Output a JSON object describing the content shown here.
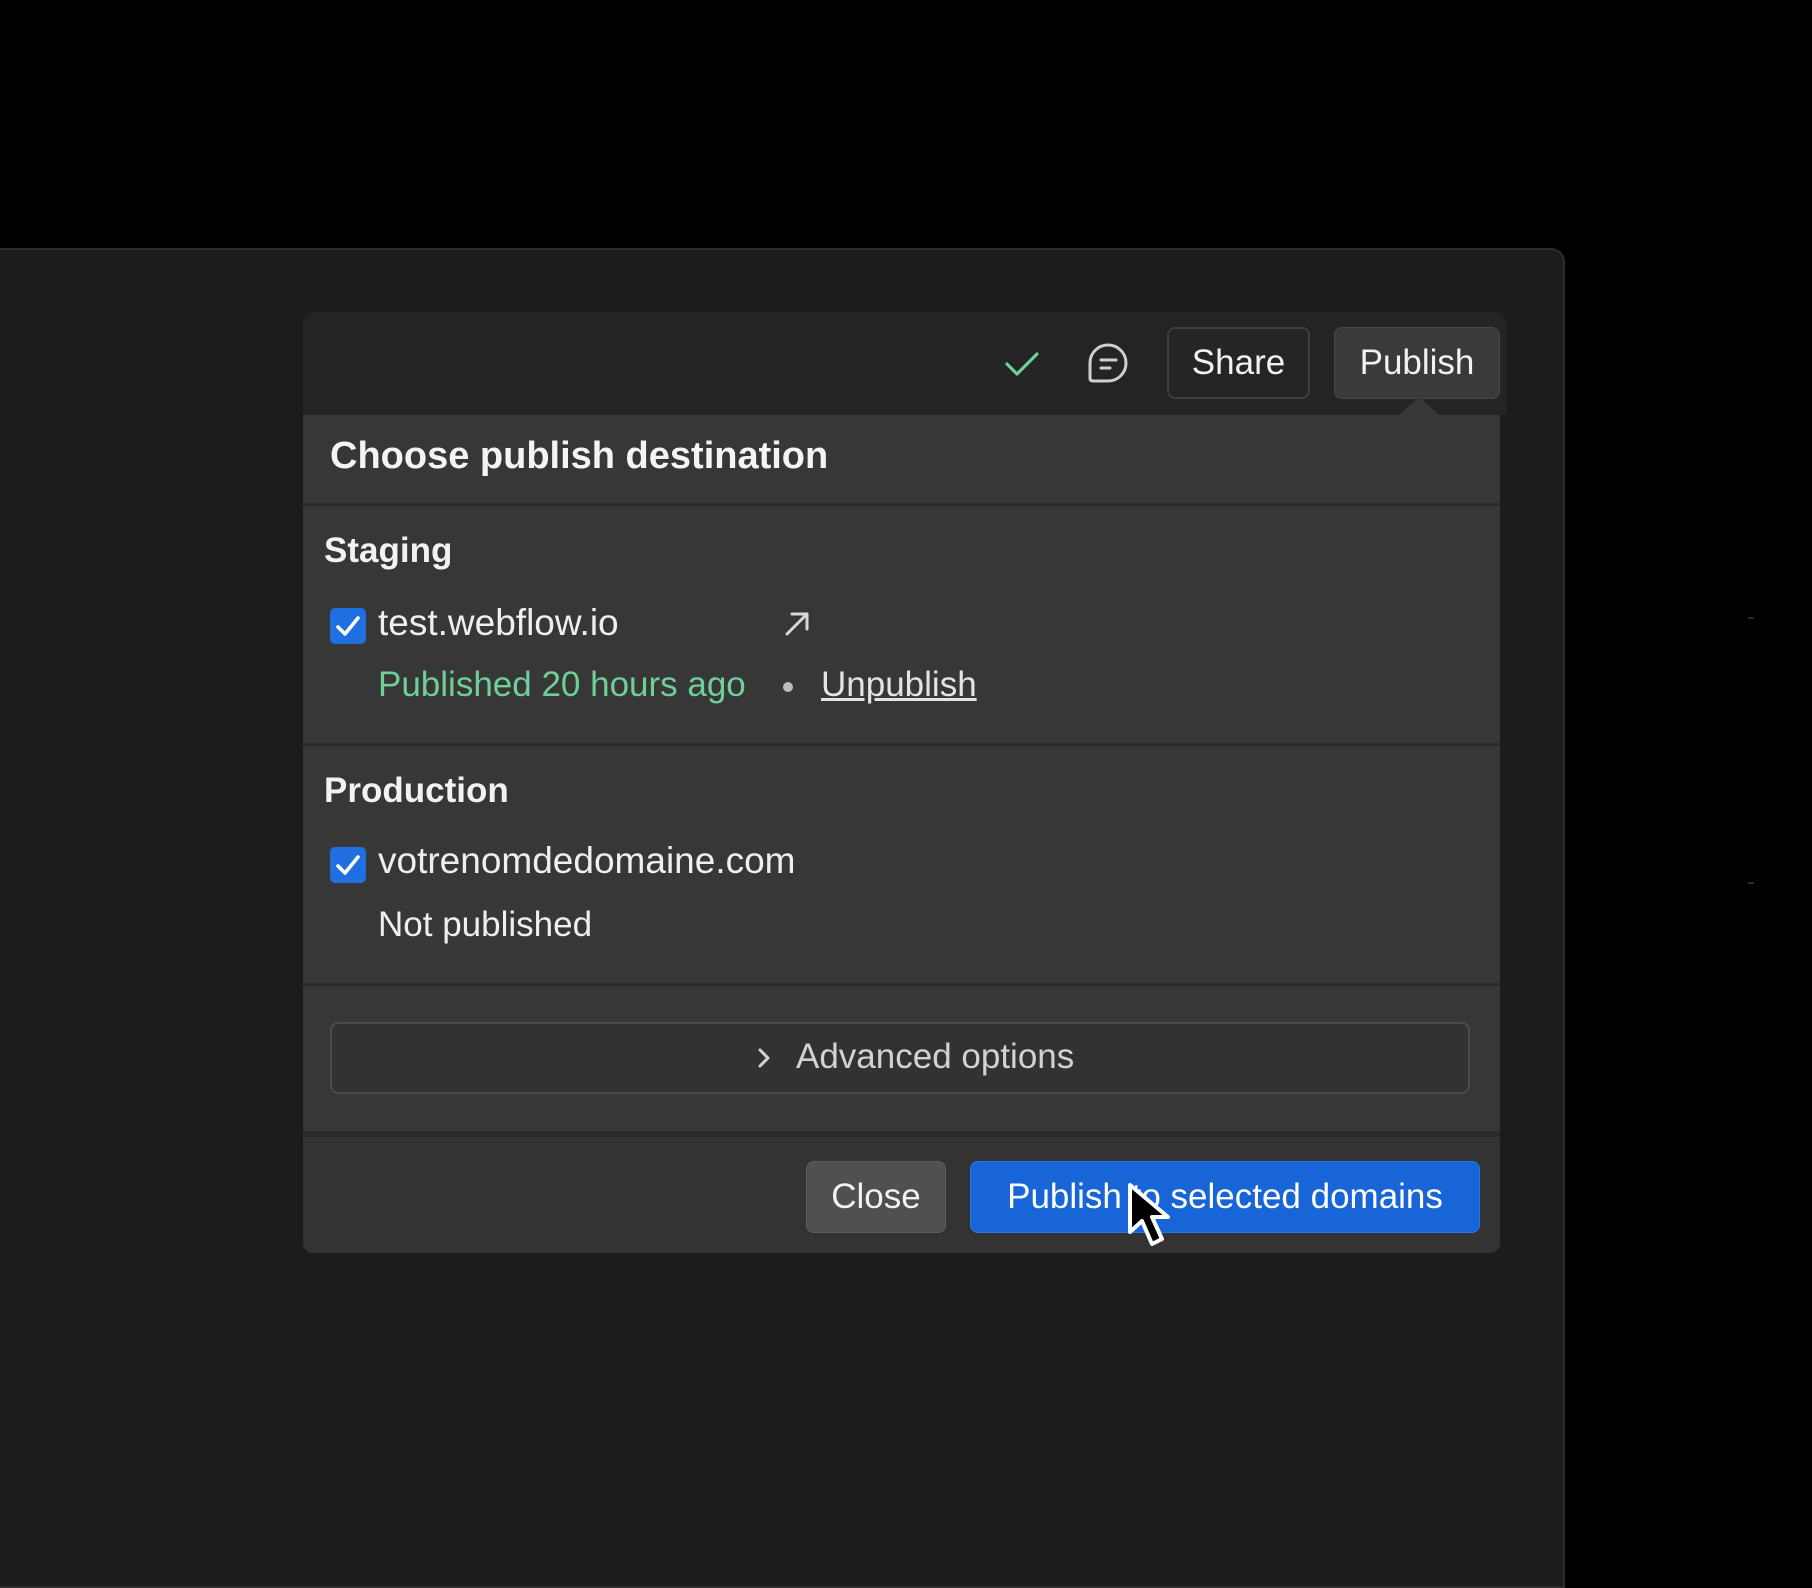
{
  "toolbar": {
    "status_icon": "check-icon",
    "comment_icon": "comment-icon",
    "share_label": "Share",
    "publish_label": "Publish"
  },
  "dialog": {
    "title": "Choose publish destination",
    "staging": {
      "heading": "Staging",
      "domain": "test.webflow.io",
      "checked": true,
      "status": "Published 20 hours ago",
      "unpublish_label": "Unpublish"
    },
    "production": {
      "heading": "Production",
      "domain": "votrenomdedomaine.com",
      "checked": true,
      "status": "Not published"
    },
    "advanced_label": "Advanced options",
    "close_label": "Close",
    "primary_label": "Publish to selected domains"
  },
  "colors": {
    "accent": "#1765d6",
    "success": "#6fcf97",
    "panel": "#373737",
    "background": "#1c1c1c"
  }
}
